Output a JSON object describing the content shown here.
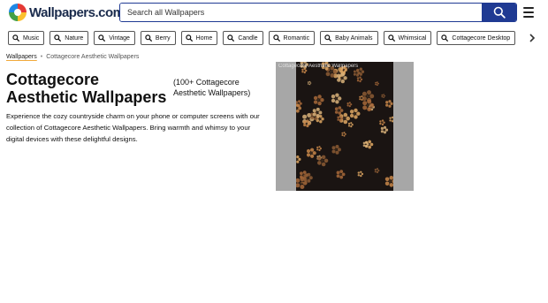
{
  "header": {
    "logo_text": "Wallpapers.com",
    "search_placeholder": "Search all Wallpapers",
    "accent_color": "#1f3a93"
  },
  "categories": [
    {
      "label": "Music",
      "icon": "search-icon"
    },
    {
      "label": "Nature",
      "icon": "search-icon"
    },
    {
      "label": "Vintage",
      "icon": "search-icon"
    },
    {
      "label": "Berry",
      "icon": "search-icon"
    },
    {
      "label": "Home",
      "icon": "search-icon"
    },
    {
      "label": "Candle",
      "icon": "search-icon"
    },
    {
      "label": "Romantic",
      "icon": "search-icon"
    },
    {
      "label": "Baby Animals",
      "icon": "search-icon"
    },
    {
      "label": "Whimsical",
      "icon": "search-icon"
    },
    {
      "label": "Cottagecore Desktop",
      "icon": "search-icon"
    }
  ],
  "breadcrumb": {
    "root": "Wallpapers",
    "separator": "•",
    "current": "Cottagecore Aesthetic Wallpapers"
  },
  "main": {
    "title": "Cottagecore Aesthetic Wallpapers",
    "count_label": "(100+ Cottagecore Aesthetic Wallpapers)",
    "description": "Experience the cozy countryside charm on your phone or computer screens with our collection of Cottagecore Aesthetic Wallpapers. Bring warmth and whimsy to your digital devices with these delightful designs."
  },
  "preview": {
    "caption": "Cottagecore Aesthetic Wallpapers"
  }
}
